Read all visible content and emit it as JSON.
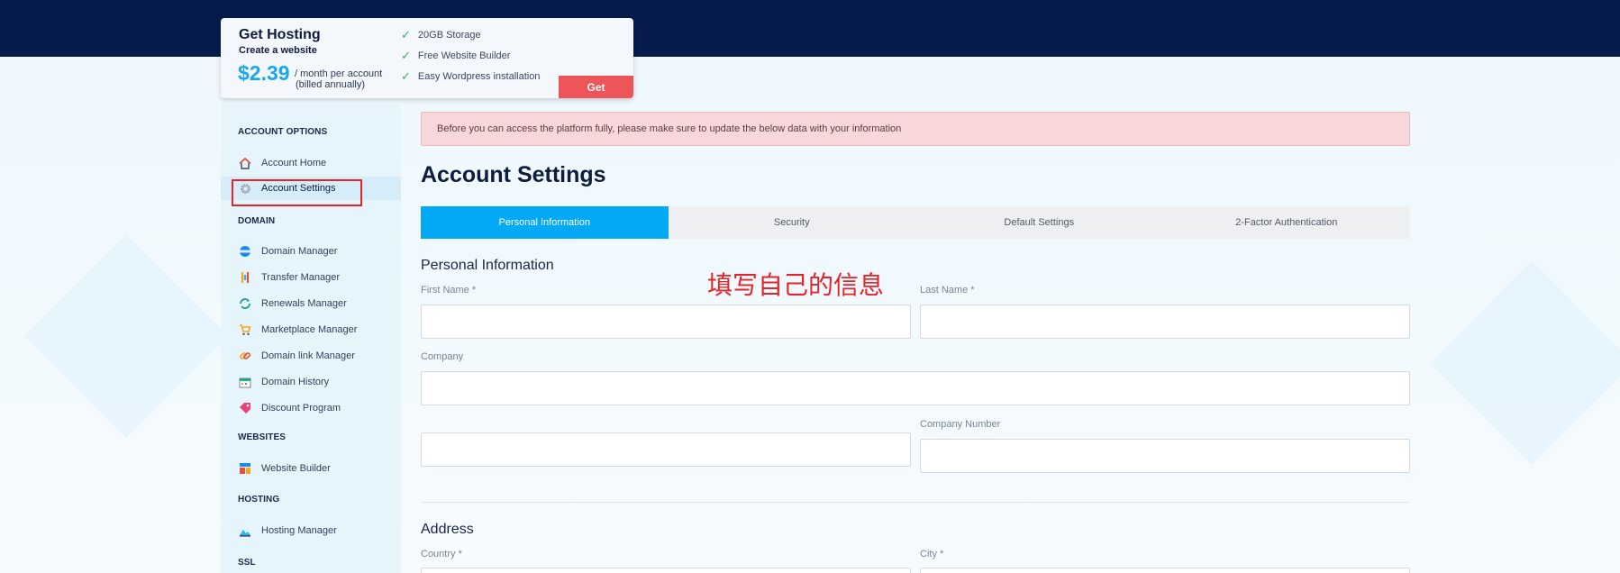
{
  "promo": {
    "title": "Get Hosting",
    "subtitle": "Create a website",
    "price": "$2.39",
    "price_note_line1": "/ month per account",
    "price_note_line2": "(billed annually)",
    "features": [
      "20GB Storage",
      "Free Website Builder",
      "Easy Wordpress installation"
    ],
    "cta_label": "Get"
  },
  "sidebar": {
    "sections": [
      {
        "heading": "ACCOUNT OPTIONS",
        "items": [
          {
            "label": "Account Home",
            "icon": "home-icon",
            "active": false
          },
          {
            "label": "Account Settings",
            "icon": "gear-icon",
            "active": true
          }
        ]
      },
      {
        "heading": "DOMAIN",
        "items": [
          {
            "label": "Domain Manager",
            "icon": "globe-icon",
            "active": false
          },
          {
            "label": "Transfer Manager",
            "icon": "transfer-icon",
            "active": false
          },
          {
            "label": "Renewals Manager",
            "icon": "refresh-icon",
            "active": false
          },
          {
            "label": "Marketplace Manager",
            "icon": "cart-icon",
            "active": false
          },
          {
            "label": "Domain link Manager",
            "icon": "link-icon",
            "active": false
          },
          {
            "label": "Domain History",
            "icon": "calendar-icon",
            "active": false
          },
          {
            "label": "Discount Program",
            "icon": "tag-icon",
            "active": false
          }
        ]
      },
      {
        "heading": "WEBSITES",
        "items": [
          {
            "label": "Website Builder",
            "icon": "builder-icon",
            "active": false
          }
        ]
      },
      {
        "heading": "HOSTING",
        "items": [
          {
            "label": "Hosting Manager",
            "icon": "server-icon",
            "active": false
          }
        ]
      },
      {
        "heading": "SSL",
        "items": []
      }
    ]
  },
  "alert": {
    "text": "Before you can access the platform fully, please make sure to update the below data with your information"
  },
  "page_title": "Account Settings",
  "tabs": [
    {
      "label": "Personal Information",
      "active": true
    },
    {
      "label": "Security",
      "active": false
    },
    {
      "label": "Default Settings",
      "active": false
    },
    {
      "label": "2-Factor Authentication",
      "active": false
    }
  ],
  "personal": {
    "section_title": "Personal Information",
    "first_name_label": "First Name *",
    "first_name_value": "",
    "last_name_label": "Last Name *",
    "last_name_value": "",
    "company_label": "Company",
    "company_value": "",
    "extra_value": "",
    "company_number_label": "Company Number",
    "company_number_value": ""
  },
  "address": {
    "section_title": "Address",
    "country_label": "Country *",
    "city_label": "City *"
  },
  "annotation": {
    "text": "填写自己的信息"
  },
  "colors": {
    "topbar": "#061a4c",
    "accent": "#03a9f4",
    "cta": "#ee5558",
    "alert_bg": "#f8d7da",
    "annotation": "#e4242b"
  }
}
